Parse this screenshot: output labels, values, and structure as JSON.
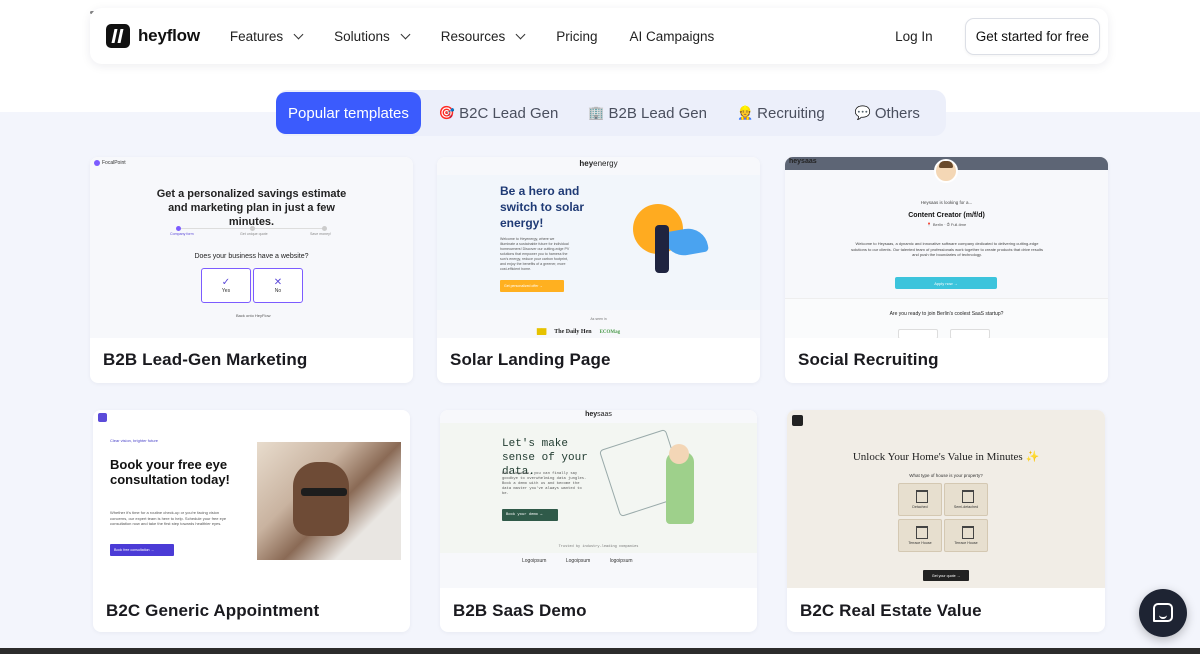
{
  "nav": {
    "brand": "heyflow",
    "items": [
      {
        "label": "Features",
        "dropdown": true
      },
      {
        "label": "Solutions",
        "dropdown": true
      },
      {
        "label": "Resources",
        "dropdown": true
      },
      {
        "label": "Pricing",
        "dropdown": false
      },
      {
        "label": "AI Campaigns",
        "dropdown": false
      }
    ],
    "login": "Log In",
    "cta": "Get started  for free"
  },
  "tabs": [
    {
      "label": "Popular templates",
      "emoji": "",
      "active": true
    },
    {
      "label": "B2C Lead Gen",
      "emoji": "🎯",
      "active": false
    },
    {
      "label": "B2B Lead Gen",
      "emoji": "🏢",
      "active": false
    },
    {
      "label": "Recruiting",
      "emoji": "👷",
      "active": false
    },
    {
      "label": "Others",
      "emoji": "💬",
      "active": false
    }
  ],
  "cards": [
    {
      "title": "B2B Lead-Gen Marketing",
      "thumb": {
        "brand": "FocalPoint",
        "headline": "Get a personalized savings estimate and marketing plan in just a few minutes.",
        "steps": [
          "Company form",
          "Get unique quote",
          "Save money!"
        ],
        "question": "Does your business have a website?",
        "yes": "Yes",
        "no": "No",
        "back": "Back onto HeyFlow"
      }
    },
    {
      "title": "Solar Landing Page",
      "thumb": {
        "brand_a": "hey",
        "brand_b": "energy",
        "headline": "Be a hero and switch to solar energy!",
        "body": "Welcome to Heyenergy, where we illuminate a sustainable future for individual homeowners! Discover our cutting-edge PV solutions that empower you to harness the sun's energy, reduce your carbon footprint, and enjoy the benefits of a greener, more cost-efficient home.",
        "button": "Get personalized offer →",
        "seen": "As seen in",
        "logos": [
          "The Daily Hen",
          "ECOMag"
        ]
      }
    },
    {
      "title": "Social Recruiting",
      "thumb": {
        "brand": "heysaas",
        "looking": "Heysaas is looking for a...",
        "role": "Content Creator (m/f/d)",
        "location": "📍 Berlin  ·  ⏱ Full-time",
        "body": "Welcome to Heysaas, a dynamic and innovative software company dedicated to delivering cutting-edge solutions to our clients. Our talented team of professionals work together to create products that drive results and push the boundaries of technology.",
        "button": "Apply now →",
        "question": "Are you ready to join Berlin's coolest SaaS startup?"
      }
    },
    {
      "title": "B2C Generic Appointment",
      "thumb": {
        "tag": "Clear vision, brighter future",
        "headline": "Book your free eye consultation today!",
        "body": "Whether it's time for a routine check-up or you're facing vision concerns, our expert team is here to help. Schedule your free eye consultation now and take the first step towards healthier eyes.",
        "button": "Book free consultation →"
      }
    },
    {
      "title": "B2B SaaS Demo",
      "thumb": {
        "brand_a": "hey",
        "brand_b": "saas",
        "headline": "Let's make sense of your data.",
        "body": "With Heysaas, you can finally say goodbye to overwhelming data jungles. Book a demo with us and become the data master you've always wanted to be.",
        "button": "Book your demo →",
        "trust": "Trusted by industry-leading companies",
        "logos": [
          "Logoipsum",
          "Logoipsum",
          "logoipsum"
        ]
      }
    },
    {
      "title": "B2C Real Estate Value",
      "thumb": {
        "headline": "Unlock Your Home's Value in Minutes ✨",
        "question": "What type of house is your property?",
        "options": [
          {
            "label": "Detached"
          },
          {
            "label": "Semi-detached"
          },
          {
            "label": "Terrace House"
          },
          {
            "label": "Terrace House"
          }
        ],
        "button": "Get your quote →"
      }
    }
  ],
  "colors": {
    "accent": "#3b5bfd",
    "page_bg": "#f3f5fc",
    "chat_bg": "#1e2433"
  }
}
